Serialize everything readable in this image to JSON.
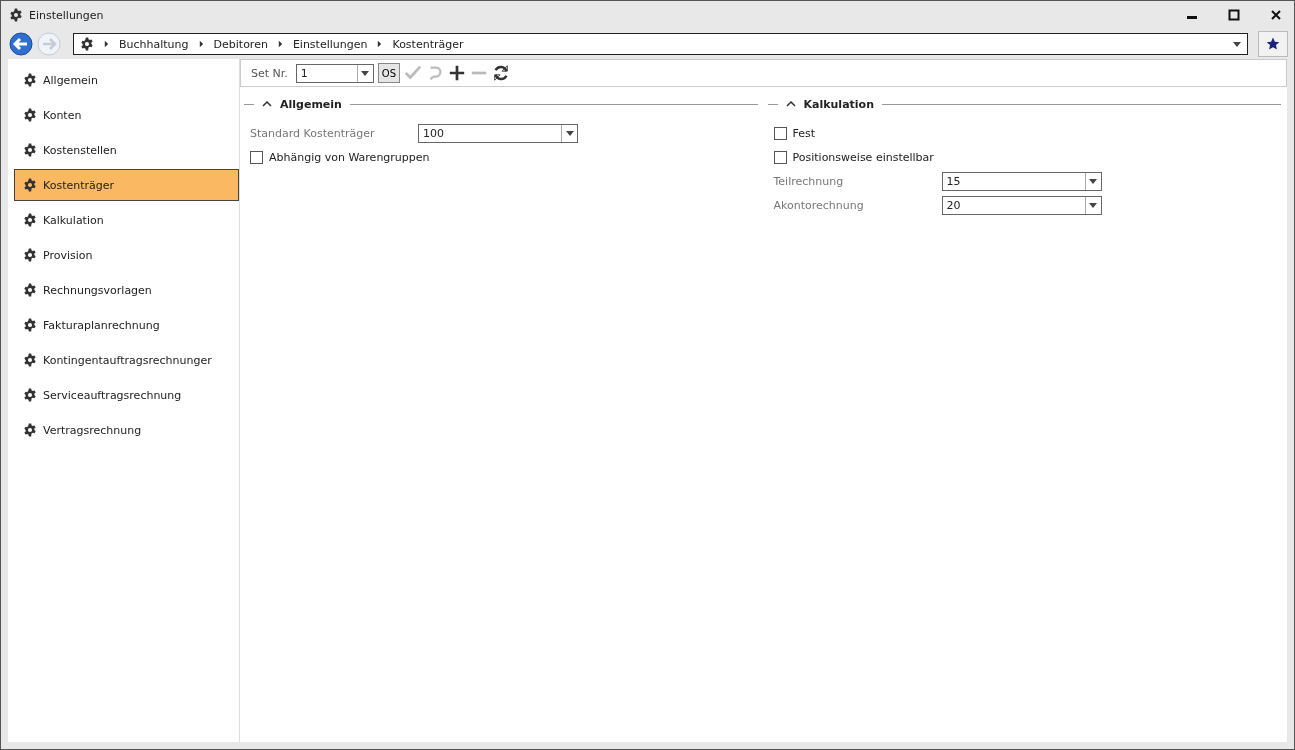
{
  "window": {
    "title": "Einstellungen"
  },
  "breadcrumb": [
    "Buchhaltung",
    "Debitoren",
    "Einstellungen",
    "Kostenträger"
  ],
  "sidebar": {
    "items": [
      {
        "label": "Allgemein",
        "selected": false
      },
      {
        "label": "Konten",
        "selected": false
      },
      {
        "label": "Kostenstellen",
        "selected": false
      },
      {
        "label": "Kostenträger",
        "selected": true
      },
      {
        "label": "Kalkulation",
        "selected": false
      },
      {
        "label": "Provision",
        "selected": false
      },
      {
        "label": "Rechnungsvorlagen",
        "selected": false
      },
      {
        "label": "Fakturaplanrechnung",
        "selected": false
      },
      {
        "label": "Kontingentauftragsrechnunger",
        "selected": false
      },
      {
        "label": "Serviceauftragsrechnung",
        "selected": false
      },
      {
        "label": "Vertragsrechnung",
        "selected": false
      }
    ]
  },
  "toolbar": {
    "set_label": "Set Nr.",
    "set_value": "1",
    "os_label": "OS",
    "tools": [
      {
        "kind": "check",
        "disabled": true
      },
      {
        "kind": "undo",
        "disabled": true
      },
      {
        "kind": "plus",
        "disabled": false
      },
      {
        "kind": "minus",
        "disabled": true
      },
      {
        "kind": "refresh",
        "disabled": false
      }
    ]
  },
  "sections": [
    {
      "title": "Allgemein",
      "expanded": true,
      "rows": [
        {
          "kind": "dropdown",
          "label": "Standard Kostenträger",
          "value": "100"
        },
        {
          "kind": "checkbox",
          "label": "Abhängig von Warengruppen",
          "checked": false
        }
      ]
    },
    {
      "title": "Kalkulation",
      "expanded": true,
      "rows": [
        {
          "kind": "checkbox",
          "label": "Fest",
          "checked": false
        },
        {
          "kind": "checkbox",
          "label": "Positionsweise einstellbar",
          "checked": false
        },
        {
          "kind": "dropdown",
          "label": "Teilrechnung",
          "value": "15"
        },
        {
          "kind": "dropdown",
          "label": "Akontorechnung",
          "value": "20"
        }
      ]
    }
  ]
}
